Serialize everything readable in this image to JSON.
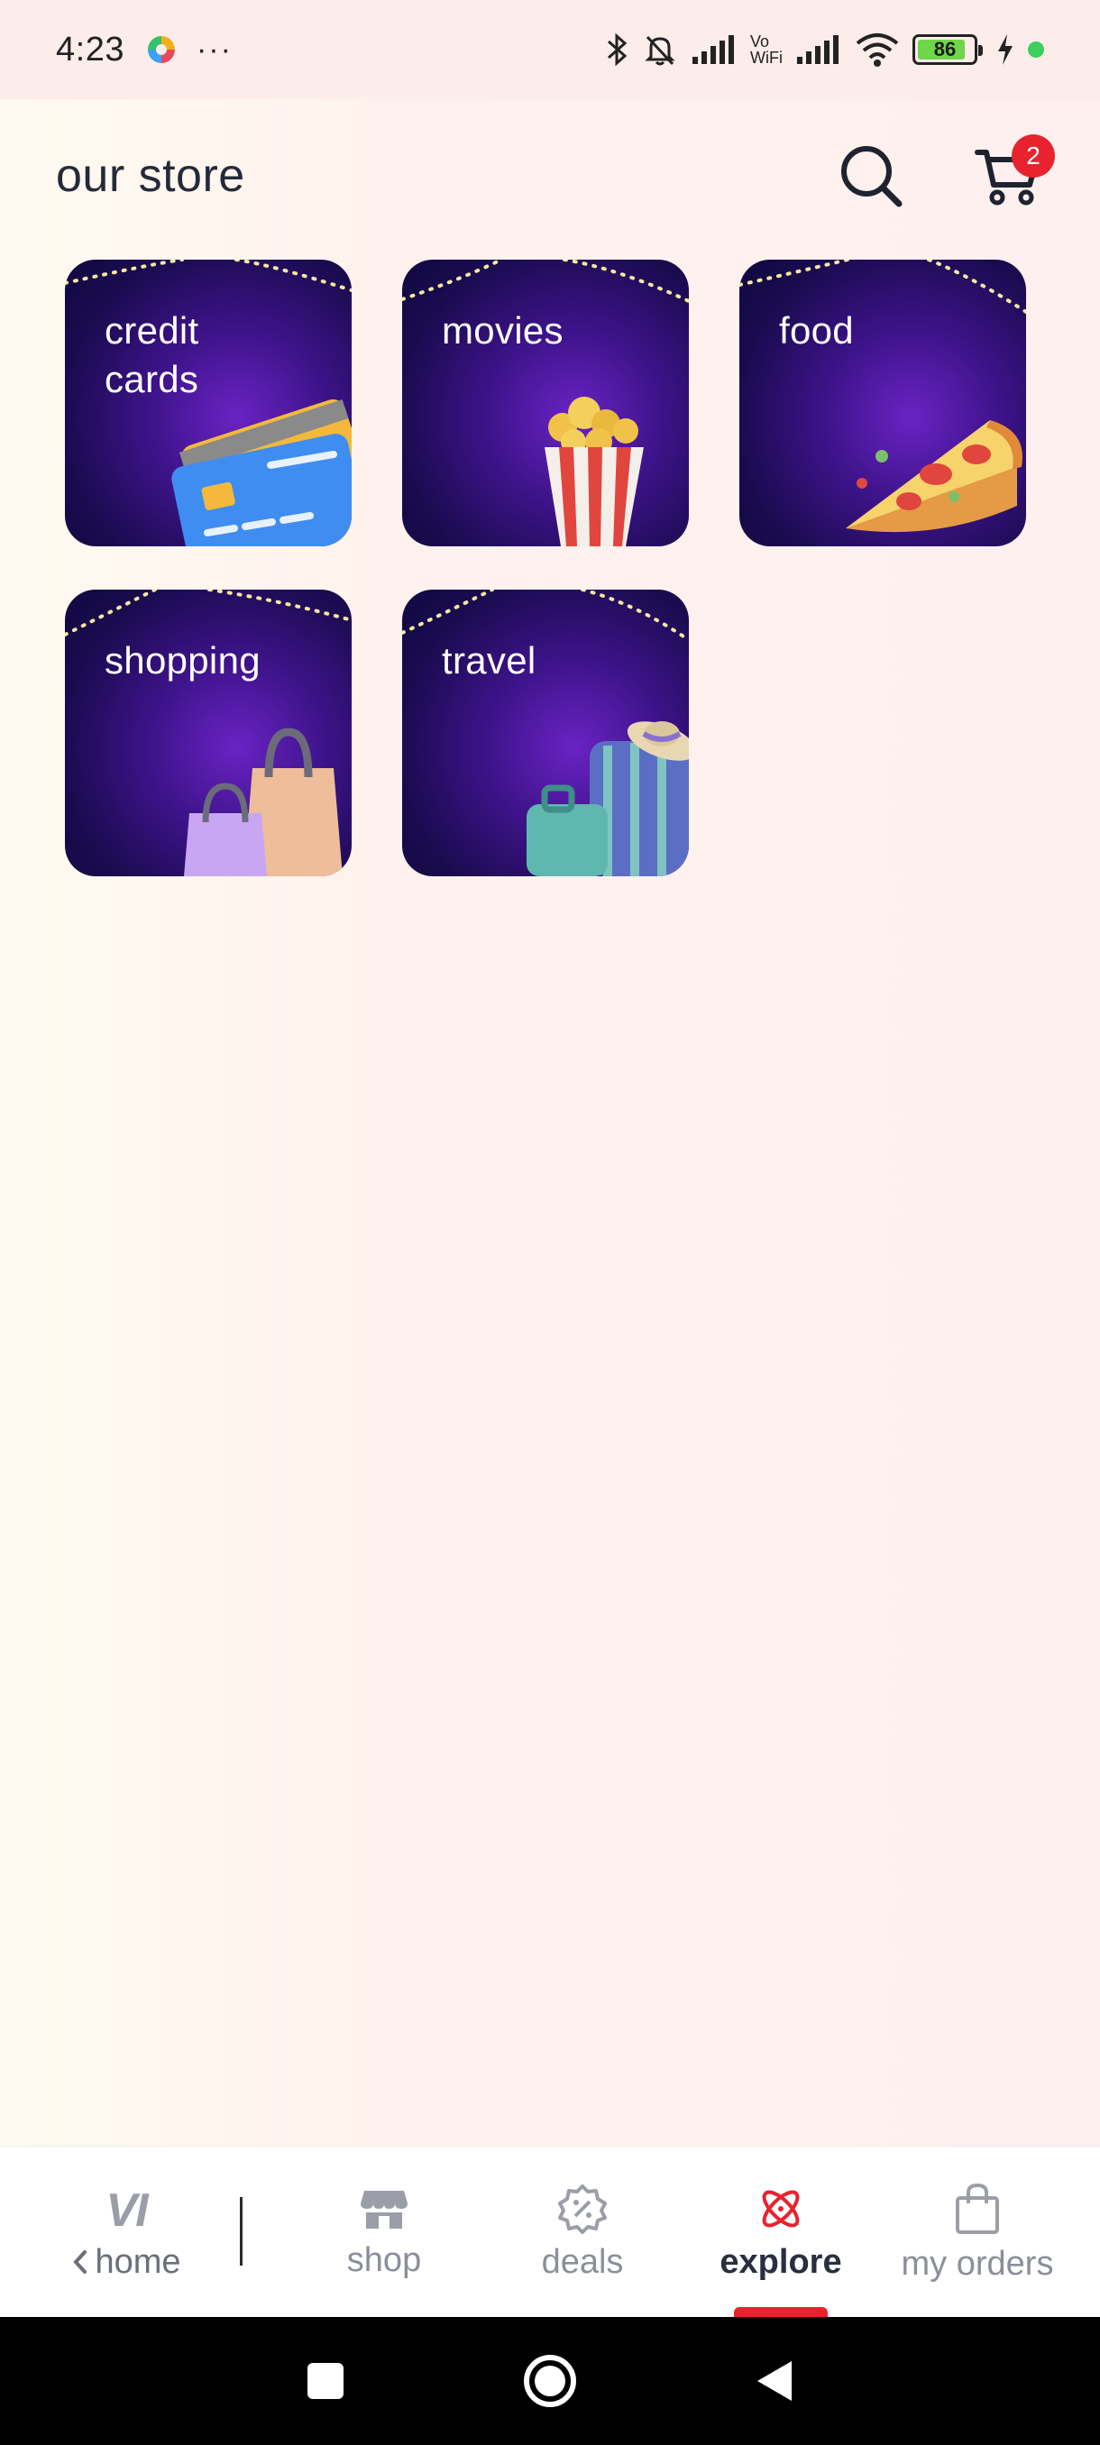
{
  "status_bar": {
    "time": "4:23",
    "more": "···",
    "vowifi_top": "Vo",
    "vowifi_bottom": "WiFi",
    "battery_level": "86",
    "battery_percent": 86
  },
  "header": {
    "title": "our store",
    "cart_count": "2"
  },
  "categories": [
    {
      "label": "credit cards",
      "icon": "credit-card-icon"
    },
    {
      "label": "movies",
      "icon": "popcorn-icon"
    },
    {
      "label": "food",
      "icon": "pizza-icon"
    },
    {
      "label": "shopping",
      "icon": "shopping-bags-icon"
    },
    {
      "label": "travel",
      "icon": "luggage-icon"
    }
  ],
  "bottom_nav": {
    "home_logo": "VI",
    "home": "home",
    "items": [
      {
        "label": "shop",
        "icon": "store-icon"
      },
      {
        "label": "deals",
        "icon": "discount-badge-icon"
      },
      {
        "label": "explore",
        "icon": "atom-icon",
        "active": true
      },
      {
        "label": "my orders",
        "icon": "bag-icon"
      }
    ]
  },
  "colors": {
    "accent": "#e8232f",
    "tile_dark": "#1a0b4f",
    "tile_glow": "#6a23c4"
  }
}
